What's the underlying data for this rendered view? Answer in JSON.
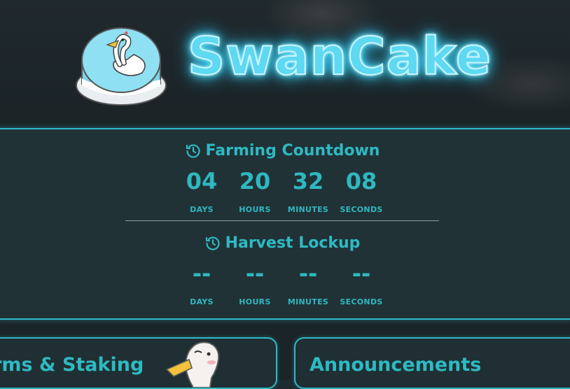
{
  "brand": {
    "name": "SwanCake"
  },
  "farming_countdown": {
    "title": "Farming Countdown",
    "units": [
      {
        "value": "04",
        "label": "DAYS"
      },
      {
        "value": "20",
        "label": "HOURS"
      },
      {
        "value": "32",
        "label": "MINUTES"
      },
      {
        "value": "08",
        "label": "SECONDS"
      }
    ]
  },
  "harvest_lockup": {
    "title": "Harvest Lockup",
    "units": [
      {
        "value": "--",
        "label": "DAYS"
      },
      {
        "value": "--",
        "label": "HOURS"
      },
      {
        "value": "--",
        "label": "MINUTES"
      },
      {
        "value": "--",
        "label": "SECONDS"
      }
    ]
  },
  "cards": {
    "farms": {
      "title": "Farms & Staking"
    },
    "announcements": {
      "title": "Announcements"
    }
  },
  "icons": {
    "clock": "history-clock-icon",
    "logo": "swan-cake-logo"
  },
  "colors": {
    "accent": "#30b7c0",
    "neon": "#5fd8f2",
    "panel": "#203236",
    "background": "#1d2a30"
  }
}
